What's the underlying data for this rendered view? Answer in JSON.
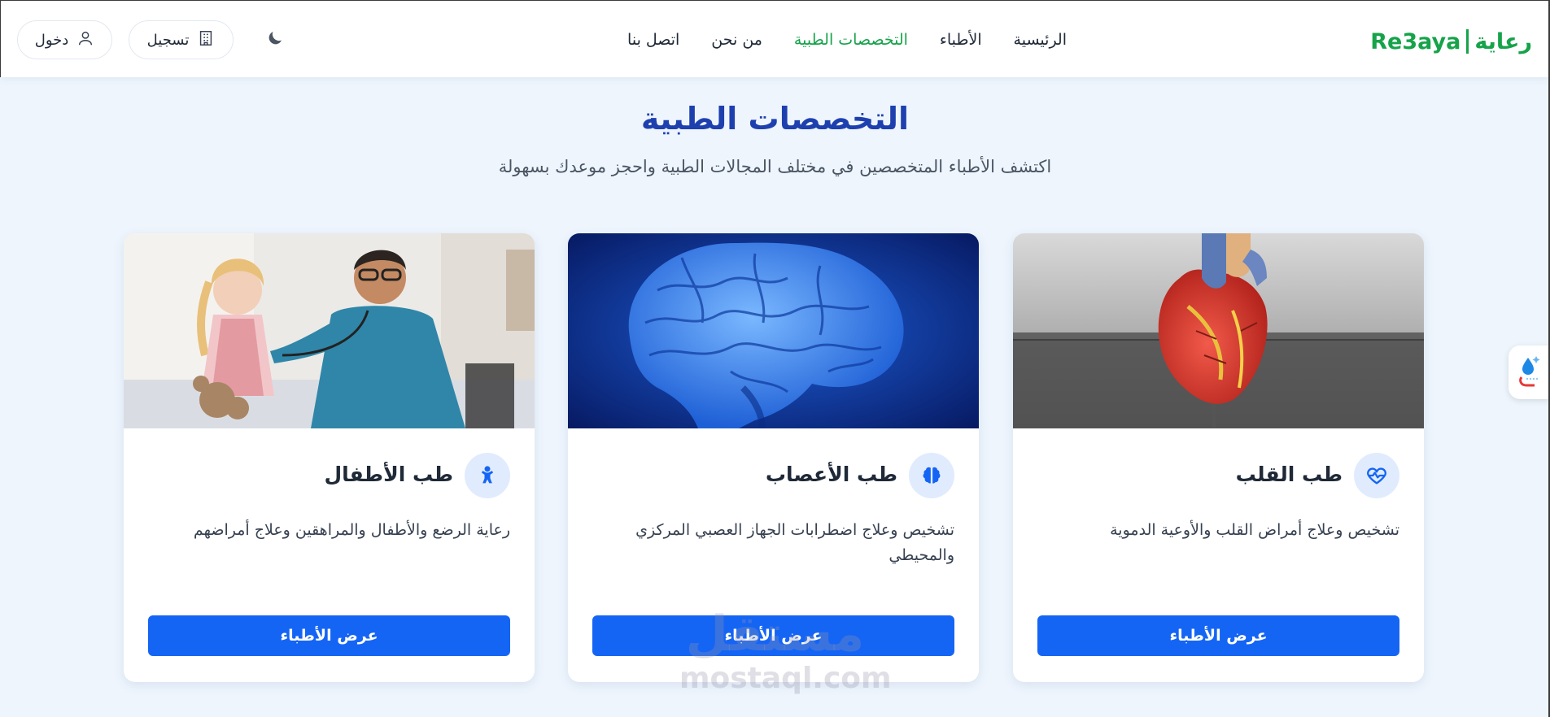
{
  "brand": {
    "arabic": "رعاية",
    "latin": "Re3aya",
    "color": "#16a34a"
  },
  "nav": [
    {
      "label": "الرئيسية",
      "active": false
    },
    {
      "label": "الأطباء",
      "active": false
    },
    {
      "label": "التخصصات الطبية",
      "active": true
    },
    {
      "label": "من نحن",
      "active": false
    },
    {
      "label": "اتصل بنا",
      "active": false
    }
  ],
  "actions": {
    "theme_icon": "moon-icon",
    "register": {
      "label": "تسجيل",
      "icon": "building-icon"
    },
    "login": {
      "label": "دخول",
      "icon": "user-icon"
    }
  },
  "section": {
    "title": "التخصصات الطبية",
    "subtitle": "اكتشف الأطباء المتخصصين في مختلف المجالات الطبية واحجز موعدك بسهولة"
  },
  "cards": [
    {
      "title": "طب القلب",
      "description": "تشخيص وعلاج أمراض القلب والأوعية الدموية",
      "icon": "heart-pulse-icon",
      "image": "heart-model-photo",
      "button": "عرض الأطباء"
    },
    {
      "title": "طب الأعصاب",
      "description": "تشخيص وعلاج اضطرابات الجهاز العصبي المركزي والمحيطي",
      "icon": "brain-icon",
      "image": "brain-render-photo",
      "button": "عرض الأطباء"
    },
    {
      "title": "طب الأطفال",
      "description": "رعاية الرضع والأطفال والمراهقين وعلاج أمراضهم",
      "icon": "baby-icon",
      "image": "pediatrician-child-photo",
      "button": "عرض الأطباء"
    }
  ],
  "watermark": {
    "arabic": "مستقل",
    "latin": "mostaql.com"
  },
  "colors": {
    "primary": "#1565f5",
    "heading": "#1e40af",
    "accent": "#16a34a",
    "background": "#eef5fd"
  }
}
